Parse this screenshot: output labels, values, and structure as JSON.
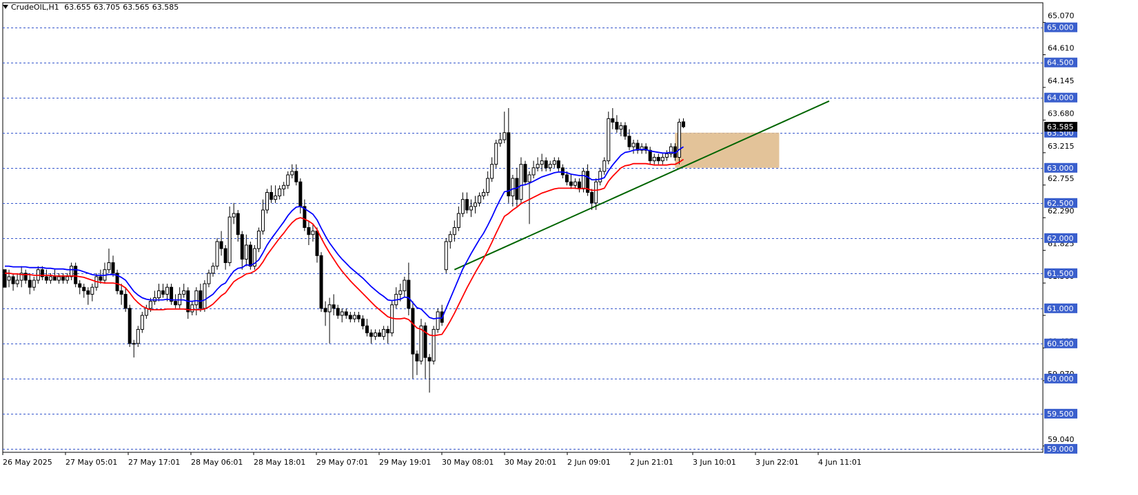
{
  "header": {
    "symbol_timeframe": "CrudeOIL,H1",
    "open": "63.655",
    "high": "63.705",
    "low": "63.565",
    "close": "63.585"
  },
  "colors": {
    "background": "#ffffff",
    "axis": "#000000",
    "grid_level": "#3355cc",
    "level_label_bg": "#3a5fcd",
    "ema_fast": "#0000ff",
    "ema_slow": "#ff0000",
    "trendline": "#006400",
    "zone_fill": "#deb887",
    "candle_up_fill": "#ffffff",
    "candle_down_fill": "#000000",
    "candle_outline": "#000000"
  },
  "chart_data": {
    "type": "candlestick",
    "symbol": "CrudeOIL",
    "timeframe": "H1",
    "price_axis_labels": [
      "65.070",
      "64.610",
      "64.145",
      "63.680",
      "63.215",
      "62.755",
      "62.290",
      "61.825",
      "61.360",
      "60.900",
      "60.435",
      "59.970",
      "59.040"
    ],
    "level_lines": [
      "65.000",
      "64.500",
      "64.000",
      "63.500",
      "63.000",
      "62.500",
      "62.000",
      "61.500",
      "61.000",
      "60.500",
      "60.000",
      "59.500",
      "59.000"
    ],
    "current_price_label": "63.585",
    "time_axis_labels": [
      "26 May 2025",
      "27 May 05:01",
      "27 May 17:01",
      "28 May 06:01",
      "28 May 18:01",
      "29 May 07:01",
      "29 May 19:01",
      "30 May 08:01",
      "30 May 20:01",
      "2 Jun 09:01",
      "2 Jun 21:01",
      "3 Jun 10:01",
      "3 Jun 22:01",
      "4 Jun 11:01"
    ],
    "ylim": [
      58.95,
      65.35
    ],
    "candles": [
      [
        61.55,
        61.55,
        61.45,
        61.3
      ],
      [
        61.4,
        61.55,
        61.3,
        61.45
      ],
      [
        61.45,
        61.5,
        61.25,
        61.35
      ],
      [
        61.35,
        61.5,
        61.3,
        61.4
      ],
      [
        61.4,
        61.6,
        61.3,
        61.5
      ],
      [
        61.5,
        61.55,
        61.35,
        61.4
      ],
      [
        61.4,
        61.5,
        61.2,
        61.3
      ],
      [
        61.3,
        61.45,
        61.25,
        61.4
      ],
      [
        61.4,
        61.6,
        61.35,
        61.55
      ],
      [
        61.55,
        61.6,
        61.4,
        61.45
      ],
      [
        61.45,
        61.55,
        61.35,
        61.4
      ],
      [
        61.4,
        61.5,
        61.35,
        61.45
      ],
      [
        61.45,
        61.55,
        61.4,
        61.4
      ],
      [
        61.4,
        61.5,
        61.35,
        61.45
      ],
      [
        61.45,
        61.5,
        61.35,
        61.4
      ],
      [
        61.4,
        61.5,
        61.35,
        61.45
      ],
      [
        61.45,
        61.65,
        61.4,
        61.6
      ],
      [
        61.6,
        61.65,
        61.3,
        61.35
      ],
      [
        61.35,
        61.4,
        61.2,
        61.3
      ],
      [
        61.3,
        61.35,
        61.15,
        61.25
      ],
      [
        61.25,
        61.3,
        61.05,
        61.2
      ],
      [
        61.2,
        61.35,
        61.1,
        61.3
      ],
      [
        61.3,
        61.5,
        61.25,
        61.45
      ],
      [
        61.45,
        61.55,
        61.35,
        61.4
      ],
      [
        61.4,
        61.65,
        61.35,
        61.55
      ],
      [
        61.55,
        61.85,
        61.5,
        61.65
      ],
      [
        61.65,
        61.75,
        61.45,
        61.5
      ],
      [
        61.5,
        61.55,
        61.2,
        61.25
      ],
      [
        61.25,
        61.35,
        61.05,
        61.2
      ],
      [
        61.2,
        61.3,
        60.95,
        61.0
      ],
      [
        61.0,
        61.05,
        60.45,
        60.5
      ],
      [
        60.5,
        60.55,
        60.3,
        60.5
      ],
      [
        60.5,
        60.75,
        60.45,
        60.7
      ],
      [
        60.7,
        60.95,
        60.65,
        60.9
      ],
      [
        60.9,
        61.05,
        60.85,
        61.0
      ],
      [
        61.0,
        61.15,
        60.95,
        61.1
      ],
      [
        61.1,
        61.25,
        61.05,
        61.15
      ],
      [
        61.15,
        61.35,
        61.1,
        61.25
      ],
      [
        61.25,
        61.35,
        61.15,
        61.2
      ],
      [
        61.2,
        61.35,
        61.1,
        61.3
      ],
      [
        61.3,
        61.35,
        61.05,
        61.1
      ],
      [
        61.1,
        61.2,
        61.0,
        61.05
      ],
      [
        61.05,
        61.3,
        61.0,
        61.2
      ],
      [
        61.2,
        61.35,
        61.15,
        61.25
      ],
      [
        61.25,
        61.3,
        60.85,
        60.95
      ],
      [
        60.95,
        61.1,
        60.9,
        61.05
      ],
      [
        61.05,
        61.3,
        60.9,
        61.25
      ],
      [
        61.25,
        61.35,
        60.95,
        61.0
      ],
      [
        61.0,
        61.4,
        60.95,
        61.35
      ],
      [
        61.35,
        61.55,
        61.3,
        61.5
      ],
      [
        61.5,
        61.65,
        61.45,
        61.6
      ],
      [
        61.6,
        62.0,
        61.55,
        61.95
      ],
      [
        61.95,
        62.1,
        61.75,
        61.85
      ],
      [
        61.85,
        61.9,
        61.55,
        61.65
      ],
      [
        61.65,
        62.45,
        61.6,
        62.3
      ],
      [
        62.3,
        62.5,
        62.2,
        62.35
      ],
      [
        62.35,
        62.4,
        61.95,
        62.05
      ],
      [
        62.05,
        62.1,
        61.55,
        61.7
      ],
      [
        61.7,
        62.05,
        61.6,
        61.9
      ],
      [
        61.9,
        61.95,
        61.55,
        61.6
      ],
      [
        61.6,
        61.9,
        61.55,
        61.85
      ],
      [
        61.85,
        62.15,
        61.8,
        62.1
      ],
      [
        62.1,
        62.55,
        62.05,
        62.4
      ],
      [
        62.4,
        62.7,
        62.35,
        62.65
      ],
      [
        62.65,
        62.75,
        62.5,
        62.55
      ],
      [
        62.55,
        62.75,
        62.5,
        62.6
      ],
      [
        62.6,
        62.75,
        62.55,
        62.7
      ],
      [
        62.7,
        62.8,
        62.6,
        62.75
      ],
      [
        62.75,
        62.95,
        62.7,
        62.9
      ],
      [
        62.9,
        63.05,
        62.85,
        62.95
      ],
      [
        62.95,
        63.05,
        62.75,
        62.8
      ],
      [
        62.8,
        62.85,
        62.35,
        62.45
      ],
      [
        62.45,
        62.55,
        62.1,
        62.15
      ],
      [
        62.15,
        62.25,
        61.9,
        62.05
      ],
      [
        62.05,
        62.2,
        61.95,
        62.1
      ],
      [
        62.1,
        62.15,
        61.65,
        61.75
      ],
      [
        61.75,
        61.8,
        60.95,
        61.0
      ],
      [
        61.0,
        61.1,
        60.75,
        60.95
      ],
      [
        60.95,
        61.15,
        60.5,
        61.05
      ],
      [
        61.05,
        61.2,
        60.9,
        61.0
      ],
      [
        61.0,
        61.05,
        60.85,
        60.9
      ],
      [
        60.9,
        61.0,
        60.8,
        60.95
      ],
      [
        60.95,
        61.0,
        60.85,
        60.9
      ],
      [
        60.9,
        60.95,
        60.8,
        60.85
      ],
      [
        60.85,
        60.95,
        60.8,
        60.9
      ],
      [
        60.9,
        60.95,
        60.8,
        60.85
      ],
      [
        60.85,
        60.9,
        60.7,
        60.75
      ],
      [
        60.75,
        60.85,
        60.6,
        60.65
      ],
      [
        60.65,
        60.7,
        60.5,
        60.6
      ],
      [
        60.6,
        60.7,
        60.55,
        60.65
      ],
      [
        60.65,
        60.7,
        60.6,
        60.6
      ],
      [
        60.6,
        60.75,
        60.55,
        60.7
      ],
      [
        60.7,
        60.75,
        60.5,
        60.65
      ],
      [
        60.65,
        61.1,
        60.6,
        61.05
      ],
      [
        61.05,
        61.3,
        61.0,
        61.2
      ],
      [
        61.2,
        61.35,
        61.1,
        61.25
      ],
      [
        61.25,
        61.45,
        61.15,
        61.4
      ],
      [
        61.4,
        61.65,
        60.9,
        61.0
      ],
      [
        61.0,
        61.1,
        60.0,
        60.35
      ],
      [
        60.35,
        60.4,
        60.05,
        60.25
      ],
      [
        60.25,
        60.85,
        60.2,
        60.75
      ],
      [
        60.75,
        60.8,
        60.0,
        60.3
      ],
      [
        60.3,
        60.35,
        59.8,
        60.25
      ],
      [
        60.25,
        60.75,
        60.2,
        60.7
      ],
      [
        60.7,
        61.0,
        60.65,
        60.95
      ],
      [
        60.95,
        61.05,
        60.75,
        60.8
      ],
      [
        61.55,
        62.0,
        61.5,
        61.95
      ],
      [
        61.95,
        62.1,
        61.85,
        62.05
      ],
      [
        62.05,
        62.25,
        61.95,
        62.15
      ],
      [
        62.15,
        62.45,
        62.1,
        62.35
      ],
      [
        62.35,
        62.65,
        62.3,
        62.55
      ],
      [
        62.55,
        62.65,
        62.35,
        62.4
      ],
      [
        62.4,
        62.55,
        62.3,
        62.45
      ],
      [
        62.45,
        62.6,
        62.35,
        62.5
      ],
      [
        62.5,
        62.65,
        62.45,
        62.6
      ],
      [
        62.6,
        62.7,
        62.55,
        62.65
      ],
      [
        62.65,
        62.95,
        62.6,
        62.85
      ],
      [
        62.85,
        63.15,
        62.8,
        63.05
      ],
      [
        63.05,
        63.4,
        63.0,
        63.35
      ],
      [
        63.35,
        63.5,
        63.3,
        63.4
      ],
      [
        63.4,
        63.8,
        63.35,
        63.5
      ],
      [
        63.5,
        63.85,
        62.5,
        62.6
      ],
      [
        62.6,
        62.9,
        62.45,
        62.85
      ],
      [
        62.85,
        63.0,
        62.45,
        62.55
      ],
      [
        62.55,
        63.15,
        62.5,
        63.05
      ],
      [
        63.05,
        63.1,
        62.75,
        62.8
      ],
      [
        62.8,
        62.95,
        62.2,
        62.9
      ],
      [
        62.9,
        63.1,
        62.85,
        63.0
      ],
      [
        63.0,
        63.15,
        62.95,
        63.05
      ],
      [
        63.05,
        63.2,
        62.95,
        63.1
      ],
      [
        63.1,
        63.15,
        62.95,
        63.0
      ],
      [
        63.0,
        63.1,
        62.95,
        63.05
      ],
      [
        63.05,
        63.15,
        63.0,
        63.1
      ],
      [
        63.1,
        63.15,
        62.95,
        63.0
      ],
      [
        63.0,
        63.05,
        62.85,
        62.9
      ],
      [
        62.9,
        62.95,
        62.75,
        62.8
      ],
      [
        62.8,
        62.9,
        62.7,
        62.75
      ],
      [
        62.75,
        62.85,
        62.7,
        62.8
      ],
      [
        62.8,
        62.85,
        62.65,
        62.7
      ],
      [
        62.7,
        63.0,
        62.65,
        62.95
      ],
      [
        62.95,
        63.05,
        62.6,
        62.65
      ],
      [
        62.65,
        62.7,
        62.4,
        62.5
      ],
      [
        62.5,
        62.85,
        62.4,
        62.8
      ],
      [
        62.8,
        63.0,
        62.75,
        62.95
      ],
      [
        62.95,
        63.15,
        62.9,
        63.1
      ],
      [
        63.1,
        63.8,
        63.05,
        63.7
      ],
      [
        63.7,
        63.85,
        63.55,
        63.65
      ],
      [
        63.65,
        63.75,
        63.5,
        63.55
      ],
      [
        63.55,
        63.65,
        63.45,
        63.6
      ],
      [
        63.6,
        63.65,
        63.4,
        63.45
      ],
      [
        63.45,
        63.55,
        63.25,
        63.3
      ],
      [
        63.3,
        63.4,
        63.2,
        63.35
      ],
      [
        63.35,
        63.4,
        63.2,
        63.25
      ],
      [
        63.25,
        63.35,
        63.2,
        63.3
      ],
      [
        63.3,
        63.35,
        63.2,
        63.25
      ],
      [
        63.25,
        63.3,
        63.05,
        63.1
      ],
      [
        63.1,
        63.2,
        63.05,
        63.15
      ],
      [
        63.15,
        63.2,
        63.05,
        63.1
      ],
      [
        63.1,
        63.2,
        63.05,
        63.15
      ],
      [
        63.15,
        63.25,
        63.1,
        63.2
      ],
      [
        63.2,
        63.35,
        63.15,
        63.3
      ],
      [
        63.3,
        63.35,
        63.1,
        63.15
      ],
      [
        63.15,
        63.7,
        63.05,
        63.65
      ],
      [
        63.655,
        63.705,
        63.565,
        63.585
      ]
    ],
    "indicators": [
      {
        "type": "moving_average",
        "color": "blue",
        "values": [
          61.6,
          61.6,
          61.59,
          61.59,
          61.59,
          61.59,
          61.58,
          61.58,
          61.58,
          61.58,
          61.57,
          61.57,
          61.56,
          61.56,
          61.56,
          61.55,
          61.55,
          61.55,
          61.54,
          61.52,
          61.5,
          61.48,
          61.47,
          61.47,
          61.47,
          61.48,
          61.48,
          61.47,
          61.44,
          61.4,
          61.32,
          61.24,
          61.19,
          61.15,
          61.13,
          61.12,
          61.12,
          61.12,
          61.12,
          61.13,
          61.12,
          61.12,
          61.12,
          61.12,
          61.1,
          61.1,
          61.11,
          61.1,
          61.12,
          61.16,
          61.2,
          61.27,
          61.33,
          61.36,
          61.45,
          61.53,
          61.57,
          61.58,
          61.62,
          61.61,
          61.64,
          61.69,
          61.79,
          61.9,
          61.99,
          62.07,
          62.15,
          62.23,
          62.32,
          62.39,
          62.44,
          62.45,
          62.42,
          62.38,
          62.34,
          62.26,
          62.14,
          62.03,
          61.93,
          61.85,
          61.77,
          61.7,
          61.64,
          61.58,
          61.53,
          61.48,
          61.43,
          61.37,
          61.31,
          61.26,
          61.21,
          61.17,
          61.12,
          61.11,
          61.12,
          61.13,
          61.16,
          61.15,
          61.08,
          61.01,
          60.99,
          60.93,
          60.87,
          60.85,
          60.86,
          60.86,
          61.0,
          61.14,
          61.28,
          61.42,
          61.56,
          61.67,
          61.78,
          61.88,
          61.98,
          62.07,
          62.18,
          62.3,
          62.43,
          62.55,
          62.66,
          62.67,
          62.7,
          62.71,
          62.75,
          62.76,
          62.78,
          62.81,
          62.84,
          62.87,
          62.89,
          62.91,
          62.93,
          62.94,
          62.94,
          62.93,
          62.91,
          62.9,
          62.89,
          62.89,
          62.87,
          62.83,
          62.83,
          62.84,
          62.86,
          62.96,
          63.04,
          63.11,
          63.18,
          63.22,
          63.23,
          63.25,
          63.26,
          63.26,
          63.26,
          63.24,
          63.23,
          63.22,
          63.21,
          63.21,
          63.22,
          63.21,
          63.26,
          63.3
        ]
      },
      {
        "type": "moving_average",
        "color": "red",
        "values": [
          61.5,
          61.5,
          61.49,
          61.49,
          61.48,
          61.48,
          61.48,
          61.47,
          61.47,
          61.47,
          61.47,
          61.47,
          61.46,
          61.46,
          61.46,
          61.46,
          61.46,
          61.46,
          61.45,
          61.44,
          61.42,
          61.4,
          61.38,
          61.37,
          61.36,
          61.36,
          61.36,
          61.35,
          61.33,
          61.29,
          61.22,
          61.14,
          61.08,
          61.03,
          61.0,
          60.98,
          60.98,
          60.98,
          60.98,
          60.99,
          60.99,
          60.99,
          60.99,
          60.99,
          60.98,
          60.98,
          60.98,
          60.98,
          60.99,
          61.02,
          61.06,
          61.12,
          61.18,
          61.22,
          61.3,
          61.38,
          61.42,
          61.45,
          61.49,
          61.5,
          61.53,
          61.58,
          61.66,
          61.76,
          61.84,
          61.92,
          62.0,
          62.07,
          62.15,
          62.22,
          62.27,
          62.29,
          62.27,
          62.24,
          62.2,
          62.12,
          62.0,
          61.89,
          61.79,
          61.7,
          61.61,
          61.53,
          61.46,
          61.39,
          61.33,
          61.27,
          61.21,
          61.15,
          61.09,
          61.03,
          60.98,
          60.93,
          60.88,
          60.86,
          60.85,
          60.85,
          60.86,
          60.84,
          60.78,
          60.72,
          60.7,
          60.66,
          60.62,
          60.61,
          60.62,
          60.63,
          60.72,
          60.82,
          60.93,
          61.05,
          61.17,
          61.29,
          61.4,
          61.51,
          61.61,
          61.71,
          61.82,
          61.94,
          62.07,
          62.19,
          62.31,
          62.35,
          62.4,
          62.44,
          62.49,
          62.52,
          62.55,
          62.58,
          62.61,
          62.64,
          62.66,
          62.68,
          62.7,
          62.71,
          62.71,
          62.71,
          62.71,
          62.71,
          62.7,
          62.71,
          62.7,
          62.68,
          62.68,
          62.69,
          62.71,
          62.81,
          62.88,
          62.94,
          63.0,
          63.03,
          63.04,
          63.06,
          63.06,
          63.06,
          63.06,
          63.05,
          63.04,
          63.04,
          63.04,
          63.04,
          63.05,
          63.05,
          63.08,
          63.12
        ]
      }
    ],
    "trendline": {
      "from": {
        "bar": 108,
        "price": 61.55
      },
      "to": {
        "bar": 198,
        "price": 63.95
      }
    },
    "zone": {
      "from_bar": 161,
      "to_bar": 186,
      "low": 63.0,
      "high": 63.5
    },
    "grid": false
  }
}
